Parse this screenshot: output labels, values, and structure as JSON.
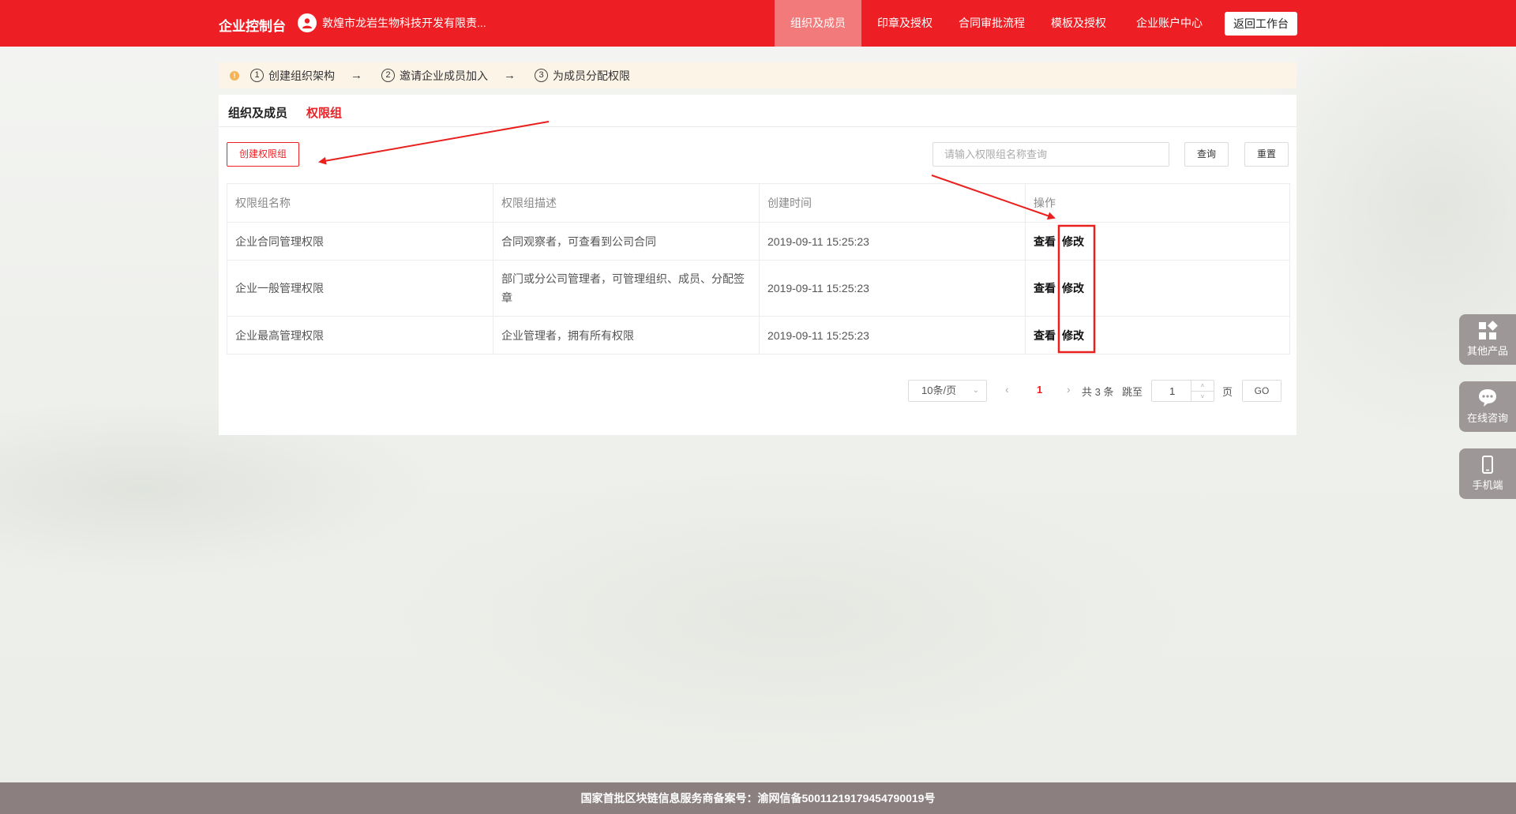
{
  "header": {
    "brand": "企业控制台",
    "org_name": "敦煌市龙岩生物科技开发有限责...",
    "nav": [
      {
        "label": "组织及成员",
        "active": true
      },
      {
        "label": "印章及授权"
      },
      {
        "label": "合同审批流程"
      },
      {
        "label": "模板及授权"
      },
      {
        "label": "企业账户中心"
      }
    ],
    "back_label": "返回工作台"
  },
  "steps": [
    {
      "num": "1",
      "label": "创建组织架构"
    },
    {
      "num": "2",
      "label": "邀请企业成员加入"
    },
    {
      "num": "3",
      "label": "为成员分配权限"
    }
  ],
  "tabs": [
    {
      "label": "组织及成员",
      "active": false
    },
    {
      "label": "权限组",
      "active": true
    }
  ],
  "toolbar": {
    "create_label": "创建权限组",
    "search_placeholder": "请输入权限组名称查询",
    "query_label": "查询",
    "reset_label": "重置"
  },
  "table": {
    "headers": [
      "权限组名称",
      "权限组描述",
      "创建时间",
      "操作"
    ],
    "rows": [
      {
        "name": "企业合同管理权限",
        "desc": "合同观察者，可查看到公司合同",
        "time": "2019-09-11 15:25:23",
        "view": "查看",
        "edit": "修改"
      },
      {
        "name": "企业一般管理权限",
        "desc": "部门或分公司管理者，可管理组织、成员、分配签章",
        "time": "2019-09-11 15:25:23",
        "view": "查看",
        "edit": "修改"
      },
      {
        "name": "企业最高管理权限",
        "desc": "企业管理者，拥有所有权限",
        "time": "2019-09-11 15:25:23",
        "view": "查看",
        "edit": "修改"
      }
    ]
  },
  "pagination": {
    "page_size": "10条/页",
    "current_page": "1",
    "total_text": "共 3 条",
    "jump_label": "跳至",
    "jump_value": "1",
    "page_unit": "页",
    "go_label": "GO"
  },
  "side": [
    {
      "label": "其他产品",
      "icon": "grid-icon"
    },
    {
      "label": "在线咨询",
      "icon": "chat-icon"
    },
    {
      "label": "手机端",
      "icon": "phone-icon"
    }
  ],
  "footer": {
    "text": "国家首批区块链信息服务商备案号：渝网信备50011219179454790019号"
  },
  "colors": {
    "brand_red": "#ee1f24",
    "nav_active": "#f27a7a",
    "footer_bg": "#8b7f80",
    "side_bg": "#9e9797",
    "steps_bg": "#fdf4e8"
  }
}
